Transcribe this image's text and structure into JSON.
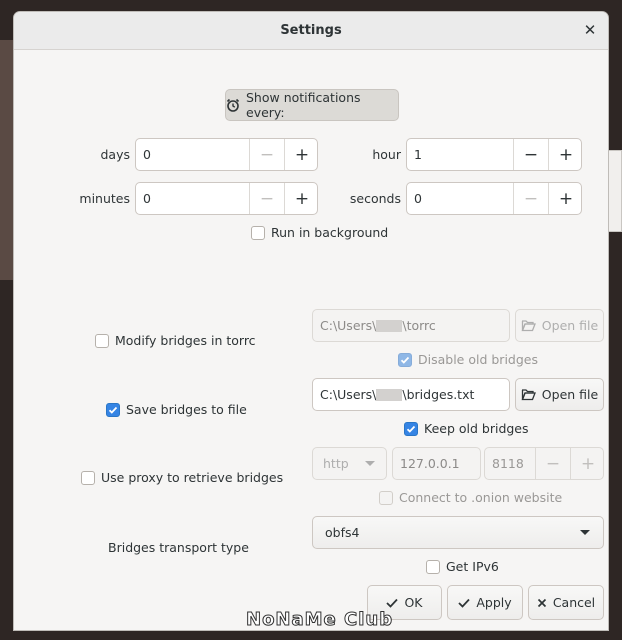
{
  "window": {
    "title": "Settings"
  },
  "notifications": {
    "button_label": "Show notifications every:"
  },
  "interval": {
    "days": {
      "label": "days",
      "value": "0"
    },
    "hour": {
      "label": "hour",
      "value": "1"
    },
    "minutes": {
      "label": "minutes",
      "value": "0"
    },
    "seconds": {
      "label": "seconds",
      "value": "0"
    }
  },
  "run_in_background": {
    "label": "Run in background",
    "checked": false
  },
  "torrc": {
    "modify_label": "Modify bridges in torrc",
    "path": "C:\\Users\\",
    "path_suffix": "\\torrc",
    "open_label": "Open file",
    "disable_old_label": "Disable old bridges"
  },
  "save_file": {
    "label": "Save bridges to file",
    "path": "C:\\Users\\",
    "path_suffix": "\\bridges.txt",
    "open_label": "Open file",
    "keep_old_label": "Keep old bridges"
  },
  "proxy": {
    "label": "Use proxy to retrieve bridges",
    "type": "http",
    "host": "127.0.0.1",
    "port": "8118",
    "onion_label": "Connect to .onion website"
  },
  "transport": {
    "label": "Bridges transport type",
    "value": "obfs4",
    "ipv6_label": "Get IPv6"
  },
  "actions": {
    "ok": "OK",
    "apply": "Apply",
    "cancel": "Cancel"
  },
  "watermark": "NoNaMe Club",
  "colors": {
    "accent": "#3584e4",
    "window_bg": "#f6f5f4",
    "desktop_bg": "#2e2624"
  }
}
